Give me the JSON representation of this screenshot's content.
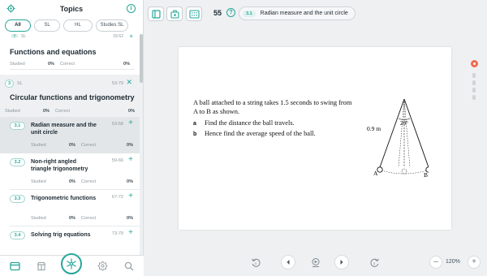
{
  "sidebar": {
    "title": "Topics",
    "filters": [
      "All",
      "SL",
      "HL",
      "Studies SL"
    ],
    "peek": {
      "num": "2",
      "sl": "SL",
      "pages": "33-52"
    },
    "section": {
      "title": "Functions and equations",
      "studied_label": "Studied",
      "studied_pct": "0%",
      "correct_label": "Correct",
      "correct_pct": "0%"
    },
    "chapter": {
      "num": "3",
      "sl": "SL",
      "pages": "53-79",
      "title": "Circular functions and trigonometry",
      "studied_label": "Studied",
      "studied_pct": "0%",
      "correct_label": "Correct",
      "correct_pct": "0%"
    },
    "subtopics": [
      {
        "num": "3.1",
        "title": "Radian measure and the unit circle",
        "pages": "53-58",
        "studied_label": "Studied",
        "studied_pct": "0%",
        "correct_label": "Correct",
        "correct_pct": "0%"
      },
      {
        "num": "3.2",
        "title": "Non-right angled triangle trigonometry",
        "pages": "59-66",
        "studied_label": "Studied",
        "studied_pct": "0%",
        "correct_label": "Correct",
        "correct_pct": "0%"
      },
      {
        "num": "3.3",
        "title": "Trigonometric functions",
        "pages": "67-72",
        "studied_label": "Studied",
        "studied_pct": "0%",
        "correct_label": "Correct",
        "correct_pct": "0%"
      },
      {
        "num": "3.4",
        "title": "Solving trig equations",
        "pages": "73-79"
      }
    ],
    "icons": {
      "settings": "gear-icon",
      "info": "info-icon"
    }
  },
  "bottom_nav": {
    "items": [
      "book-icon",
      "store-icon",
      "snowflake-icon",
      "badge-icon",
      "search-icon"
    ],
    "accent": "#26a69a"
  },
  "topbar": {
    "page_number": "55",
    "help": "?",
    "chip_num": "3.1",
    "chip_title": "Radian measure and the unit circle"
  },
  "document": {
    "question": "A ball attached to a string takes 1.5 seconds to swing from A to B as shown.",
    "items": [
      {
        "marker": "a",
        "text": "Find the distance the ball travels."
      },
      {
        "marker": "b",
        "text": "Hence find the average speed of the ball."
      }
    ],
    "diagram": {
      "angle_label": "20°",
      "length_label": "0.9 m",
      "point_a": "A",
      "point_b": "B"
    }
  },
  "controls": {
    "zoom": "120%",
    "zoom_minus": "–",
    "zoom_plus": "+"
  },
  "colors": {
    "accent": "#26a69a",
    "alert": "#f26b4f"
  }
}
